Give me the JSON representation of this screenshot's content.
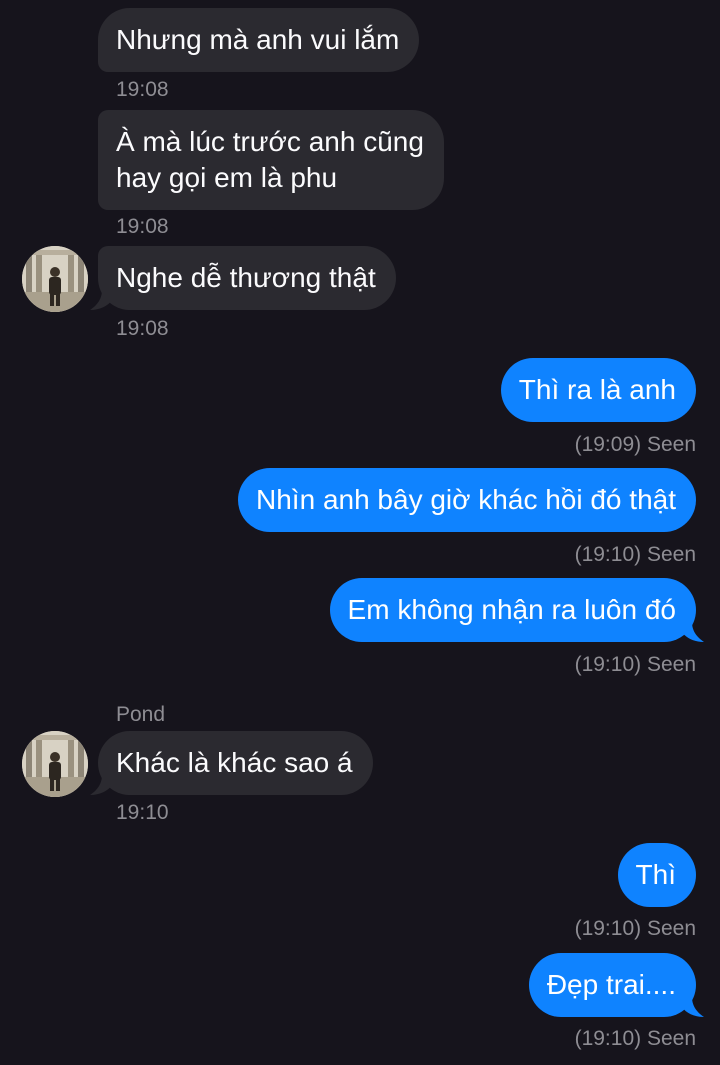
{
  "messages": [
    {
      "text": "Nhưng mà anh vui lắm",
      "time": "19:08"
    },
    {
      "text": "À mà lúc trước anh cũng hay gọi em là phu",
      "line1": "À mà lúc trước anh cũng",
      "line2": "hay gọi em là phu",
      "time": "19:08"
    },
    {
      "text": "Nghe dễ thương thật",
      "time": "19:08"
    },
    {
      "text": "Thì ra là anh",
      "status": "(19:09) Seen"
    },
    {
      "text": "Nhìn anh bây giờ khác hồi đó thật",
      "status": "(19:10) Seen"
    },
    {
      "text": "Em không nhận ra luôn đó",
      "status": "(19:10) Seen"
    },
    {
      "sender": "Pond",
      "text": "Khác là khác sao á",
      "time": "19:10"
    },
    {
      "text": "Thì",
      "status": "(19:10) Seen"
    },
    {
      "text": "Đẹp trai....",
      "status": "(19:10) Seen"
    }
  ],
  "colors": {
    "background": "#16141c",
    "incoming_bubble": "#2b2a30",
    "outgoing_bubble": "#0f83ff",
    "meta_text": "#8e8d93"
  },
  "icons": [
    "contact-avatar"
  ]
}
